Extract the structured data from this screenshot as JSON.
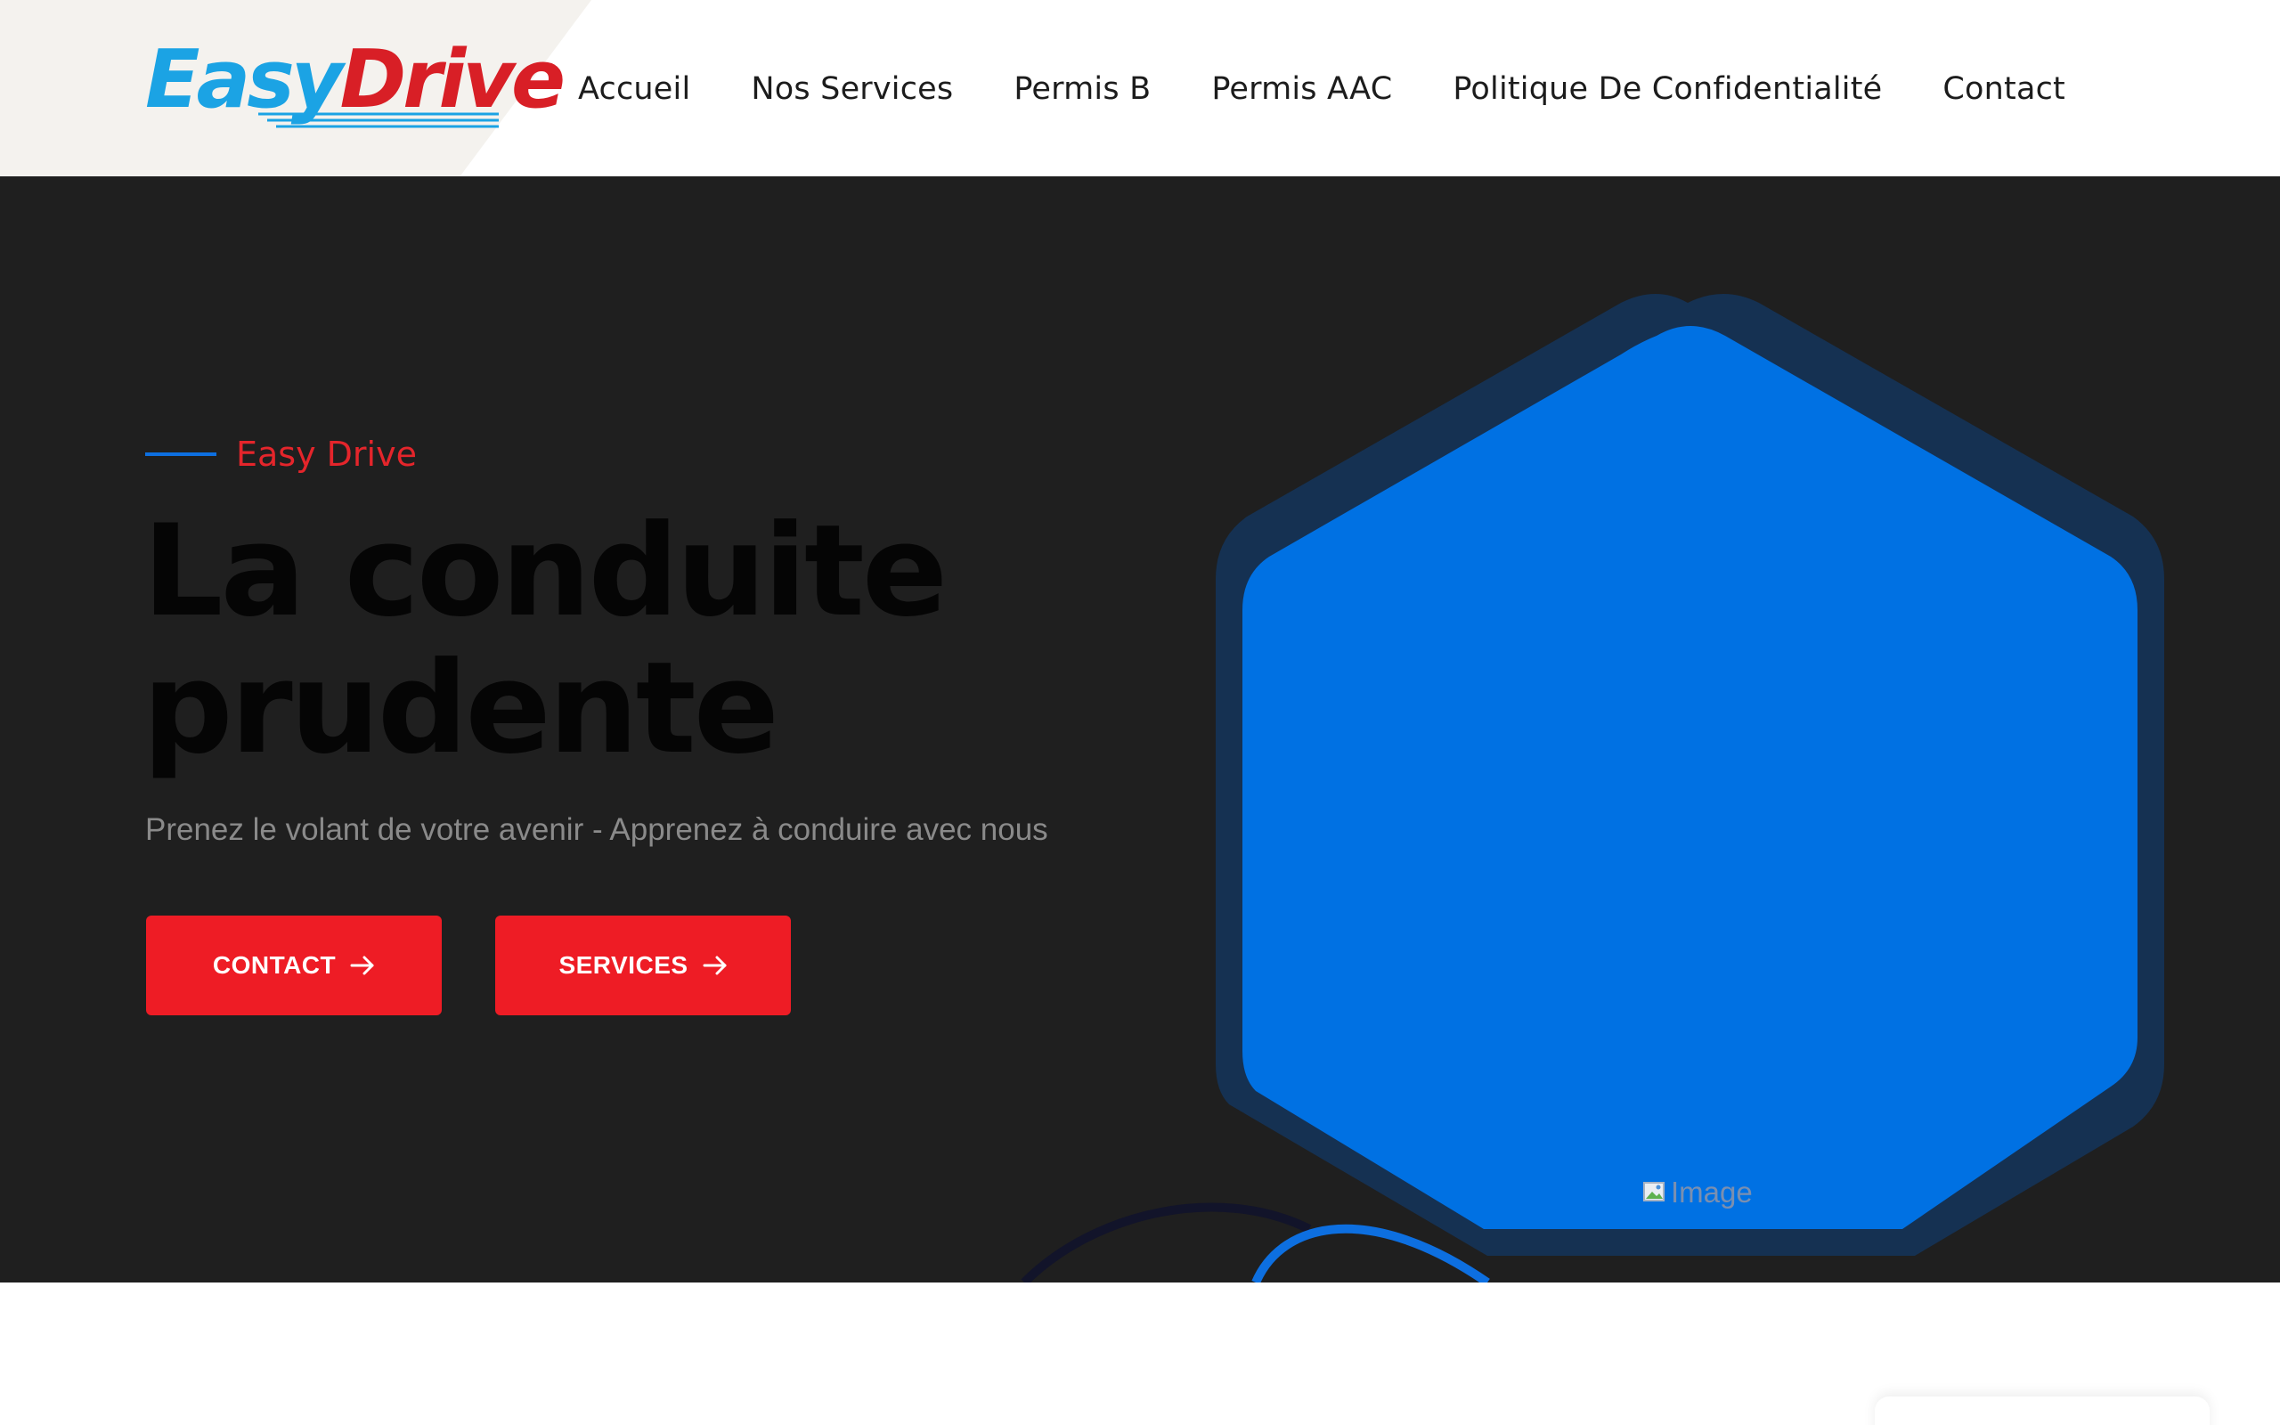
{
  "brand": {
    "logo_part1": "Easy",
    "logo_part2": "Drive",
    "logo_color_1": "#1ba3e4",
    "logo_color_2": "#d81f26"
  },
  "nav": {
    "items": [
      {
        "label": "Accueil"
      },
      {
        "label": "Nos Services"
      },
      {
        "label": "Permis B"
      },
      {
        "label": "Permis AAC"
      },
      {
        "label": "Politique De Confidentialité"
      },
      {
        "label": "Contact"
      }
    ]
  },
  "hero": {
    "tagline": "Easy Drive",
    "headline_line1": "La conduite",
    "headline_line2": "prudente",
    "subline": "Prenez le volant de votre avenir - Apprenez à conduire avec nous",
    "buttons": {
      "contact_label": "CONTACT",
      "services_label": "SERVICES"
    },
    "image_alt": "Image"
  },
  "colors": {
    "hero_background": "#1f1f1f",
    "accent_red": "#ee1c25",
    "accent_blue": "#0d6fe0",
    "hexagon_fill": "#0071e3",
    "hexagon_border": "#153152"
  },
  "icons": {
    "button_arrow": "arrow-right-icon",
    "image_placeholder": "broken-image-icon"
  }
}
